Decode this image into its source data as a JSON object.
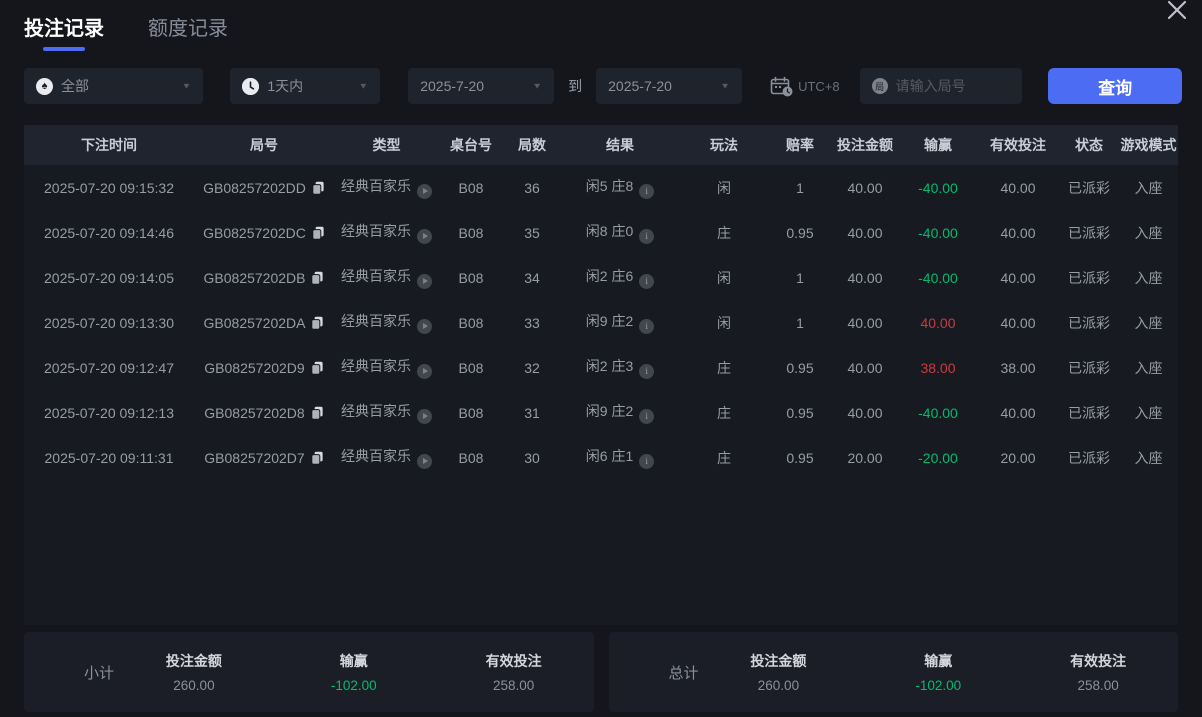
{
  "tabs": [
    {
      "label": "投注记录",
      "active": true
    },
    {
      "label": "额度记录",
      "active": false
    }
  ],
  "filters": {
    "game_type": {
      "value": "全部"
    },
    "time_range": {
      "value": "1天内"
    },
    "date_from": "2025-7-20",
    "to_label": "到",
    "date_to": "2025-7-20",
    "timezone": "UTC+8",
    "round_input_placeholder": "请输入局号",
    "search_button": "查询"
  },
  "table": {
    "headers": [
      "下注时间",
      "局号",
      "类型",
      "桌台号",
      "局数",
      "结果",
      "玩法",
      "赔率",
      "投注金额",
      "输赢",
      "有效投注",
      "状态",
      "游戏模式"
    ],
    "rows": [
      {
        "time": "2025-07-20 09:15:32",
        "round_id": "GB08257202DD",
        "type": "经典百家乐",
        "table_no": "B08",
        "round_no": "36",
        "result": "闲5 庄8",
        "play": "闲",
        "odds": "1",
        "bet": "40.00",
        "win": "-40.00",
        "valid": "40.00",
        "status": "已派彩",
        "mode": "入座"
      },
      {
        "time": "2025-07-20 09:14:46",
        "round_id": "GB08257202DC",
        "type": "经典百家乐",
        "table_no": "B08",
        "round_no": "35",
        "result": "闲8 庄0",
        "play": "庄",
        "odds": "0.95",
        "bet": "40.00",
        "win": "-40.00",
        "valid": "40.00",
        "status": "已派彩",
        "mode": "入座"
      },
      {
        "time": "2025-07-20 09:14:05",
        "round_id": "GB08257202DB",
        "type": "经典百家乐",
        "table_no": "B08",
        "round_no": "34",
        "result": "闲2 庄6",
        "play": "闲",
        "odds": "1",
        "bet": "40.00",
        "win": "-40.00",
        "valid": "40.00",
        "status": "已派彩",
        "mode": "入座"
      },
      {
        "time": "2025-07-20 09:13:30",
        "round_id": "GB08257202DA",
        "type": "经典百家乐",
        "table_no": "B08",
        "round_no": "33",
        "result": "闲9 庄2",
        "play": "闲",
        "odds": "1",
        "bet": "40.00",
        "win": "40.00",
        "valid": "40.00",
        "status": "已派彩",
        "mode": "入座"
      },
      {
        "time": "2025-07-20 09:12:47",
        "round_id": "GB08257202D9",
        "type": "经典百家乐",
        "table_no": "B08",
        "round_no": "32",
        "result": "闲2 庄3",
        "play": "庄",
        "odds": "0.95",
        "bet": "40.00",
        "win": "38.00",
        "valid": "38.00",
        "status": "已派彩",
        "mode": "入座"
      },
      {
        "time": "2025-07-20 09:12:13",
        "round_id": "GB08257202D8",
        "type": "经典百家乐",
        "table_no": "B08",
        "round_no": "31",
        "result": "闲9 庄2",
        "play": "庄",
        "odds": "0.95",
        "bet": "40.00",
        "win": "-40.00",
        "valid": "40.00",
        "status": "已派彩",
        "mode": "入座"
      },
      {
        "time": "2025-07-20 09:11:31",
        "round_id": "GB08257202D7",
        "type": "经典百家乐",
        "table_no": "B08",
        "round_no": "30",
        "result": "闲6 庄1",
        "play": "庄",
        "odds": "0.95",
        "bet": "20.00",
        "win": "-20.00",
        "valid": "20.00",
        "status": "已派彩",
        "mode": "入座"
      }
    ]
  },
  "summary": {
    "subtotal": {
      "label": "小计",
      "bet_label": "投注金额",
      "bet": "260.00",
      "win_label": "输赢",
      "win": "-102.00",
      "valid_label": "有效投注",
      "valid": "258.00"
    },
    "total": {
      "label": "总计",
      "bet_label": "投注金额",
      "bet": "260.00",
      "win_label": "输赢",
      "win": "-102.00",
      "valid_label": "有效投注",
      "valid": "258.00"
    }
  },
  "colors": {
    "accent": "#4c6cf3",
    "tab_underline": "#2f5ef5",
    "green": "#00bc6f",
    "red": "#ca3a3f"
  }
}
